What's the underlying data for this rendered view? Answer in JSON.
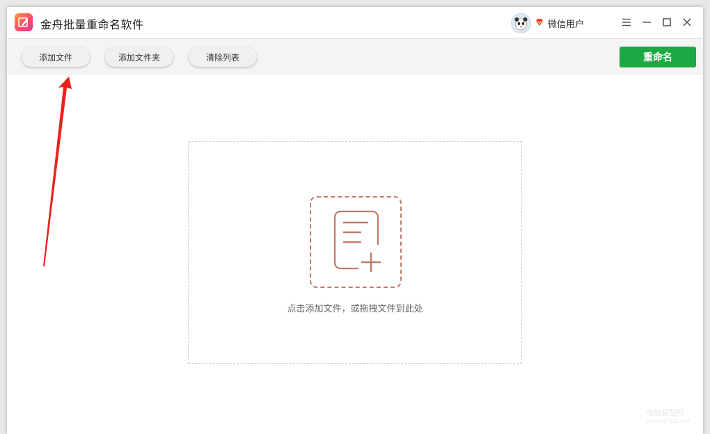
{
  "app": {
    "title": "金舟批量重命名软件",
    "logo_icon": "app-logo-icon"
  },
  "user": {
    "name": "微信用户",
    "avatar_icon": "panda-avatar",
    "badge_icon": "vip-diamond-icon"
  },
  "window_controls": {
    "menu_icon": "hamburger-menu-icon",
    "minimize_icon": "minimize-icon",
    "maximize_icon": "maximize-icon",
    "close_icon": "close-icon"
  },
  "toolbar": {
    "add_file_label": "添加文件",
    "add_folder_label": "添加文件夹",
    "clear_list_label": "清除列表",
    "rename_label": "重命名"
  },
  "dropzone": {
    "hint": "点击添加文件，或拖拽文件到此处",
    "icon": "add-file-icon"
  },
  "watermark": {
    "line1": "电脑装配网",
    "line2": "www.dnpz.net"
  },
  "colors": {
    "accent_green": "#1ea843",
    "drop_icon": "#c27a66",
    "annotation_arrow": "#e8221b"
  }
}
